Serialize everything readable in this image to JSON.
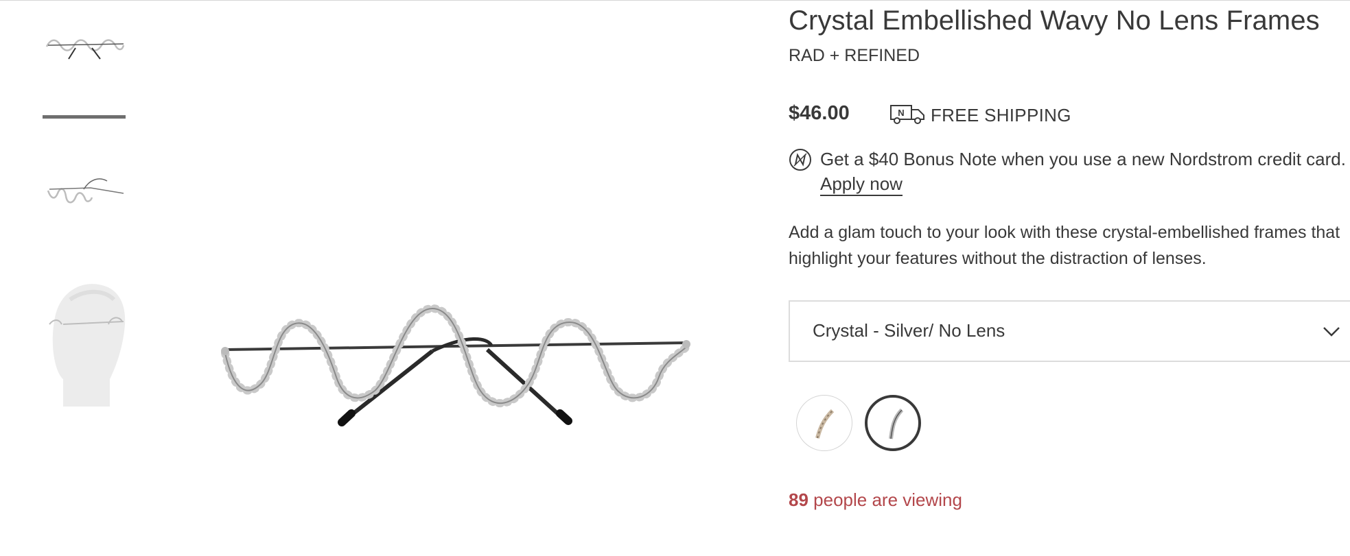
{
  "product": {
    "title": "Crystal Embellished Wavy No Lens Frames",
    "brand": "RAD + REFINED",
    "price": "$46.00",
    "shipping_label": "FREE SHIPPING",
    "shipping_icon_letter": "N",
    "bonus_text": "Get a $40 Bonus Note when you use a new Nordstrom credit card.",
    "apply_label": "Apply now",
    "description": "Add a glam touch to your look with these crystal-embellished frames that highlight your features without the distraction of lenses."
  },
  "color_select": {
    "value": "Crystal - Silver/ No Lens"
  },
  "swatches": [
    {
      "name": "tortoise",
      "selected": false
    },
    {
      "name": "crystal-silver",
      "selected": true
    }
  ],
  "viewing": {
    "count": "89",
    "text": " people are viewing"
  },
  "colors": {
    "text": "#393939",
    "viewing": "#b3474b",
    "border": "#dcdcdc"
  },
  "icons": [
    "truck-icon",
    "nordstrom-note-icon",
    "chevron-down-icon"
  ]
}
